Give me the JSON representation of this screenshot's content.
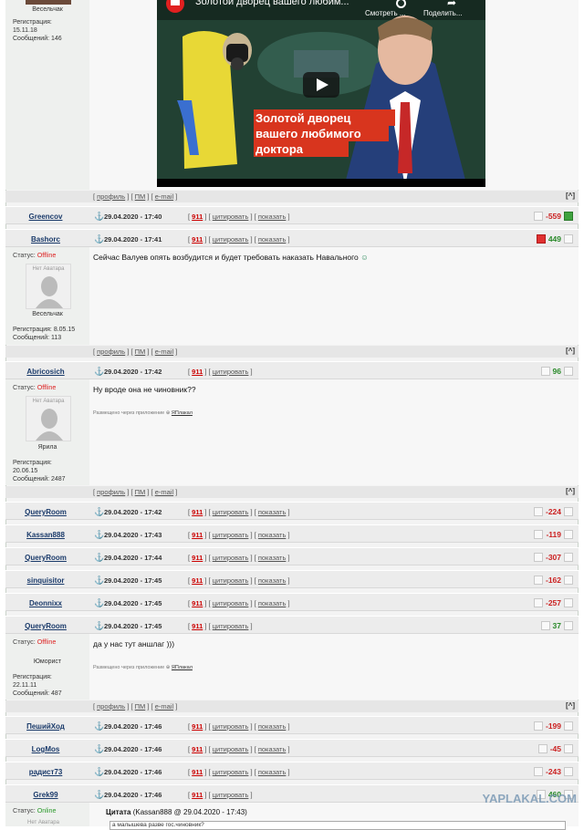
{
  "top": {
    "role": "Весельчак",
    "reg_label": "Регистрация:",
    "reg_date": "15.11.18",
    "posts": "Сообщений: 146",
    "video": {
      "title": "Золотой дворец вашего любим...",
      "watch_later": "Смотреть ...",
      "share": "Поделить...",
      "headline": "Золотой дворец вашего любимого доктора"
    }
  },
  "footer": {
    "profile": "профиль",
    "pm": "ПМ",
    "email": "e-mail",
    "top": "[^]"
  },
  "links": {
    "report": "911",
    "quote": "цитировать",
    "show": "показать"
  },
  "posts": [
    {
      "user": "Greencov",
      "date": "29.04.2020 - 17:40",
      "score": "-559"
    },
    {
      "user": "Bashorc",
      "date": "29.04.2020 - 17:41",
      "score": "449",
      "status_label": "Статус:",
      "status": "Offline",
      "avatar_caption": "Нет Аватара",
      "role": "Весельчак",
      "reg_label": "Регистрация:",
      "reg_date": "8.05.15",
      "posts_count": "Сообщений: 113",
      "text": "Сейчас Валуев опять возбудится и будет требовать наказать Навального"
    },
    {
      "user": "Abricosich",
      "date": "29.04.2020 - 17:42",
      "score": "96",
      "status_label": "Статус:",
      "status": "Offline",
      "avatar_caption": "Нет Аватара",
      "role": "Ярила",
      "reg_label": "Регистрация:",
      "reg_date": "20.06.15",
      "posts_count": "Сообщений: 2487",
      "text": "Ну вроде она не чиновник??",
      "via": "Размещено через приложение",
      "app": "ЯПлакал"
    },
    {
      "user": "QueryRoom",
      "date": "29.04.2020 - 17:42",
      "score": "-224"
    },
    {
      "user": "Kassan888",
      "date": "29.04.2020 - 17:43",
      "score": "-119"
    },
    {
      "user": "QueryRoom",
      "date": "29.04.2020 - 17:44",
      "score": "-307"
    },
    {
      "user": "sinquisitor",
      "date": "29.04.2020 - 17:45",
      "score": "-162"
    },
    {
      "user": "Deonnixx",
      "date": "29.04.2020 - 17:45",
      "score": "-257"
    },
    {
      "user": "QueryRoom",
      "date": "29.04.2020 - 17:45",
      "score": "37",
      "status_label": "Статус:",
      "status": "Offline",
      "role": "Юморист",
      "reg_label": "Регистрация:",
      "reg_date": "22.11.11",
      "posts_count": "Сообщений: 487",
      "text": "да у нас тут аншлаг )))",
      "via": "Размещено через приложение",
      "app": "ЯПлакал"
    },
    {
      "user": "ПешийХод",
      "date": "29.04.2020 - 17:46",
      "score": "-199"
    },
    {
      "user": "LogMos",
      "date": "29.04.2020 - 17:46",
      "score": "-45"
    },
    {
      "user": "радист73",
      "date": "29.04.2020 - 17:46",
      "score": "-243"
    },
    {
      "user": "Grek99",
      "date": "29.04.2020 - 17:46",
      "score": "460",
      "status_label": "Статус:",
      "status": "Online",
      "avatar_caption": "Нет Аватара",
      "quote_label": "Цитата",
      "quote_meta": "(Kassan888 @ 29.04.2020 - 17:43)",
      "quote_text": "а малышева разве гос.чиновник?"
    }
  ],
  "watermark": "YAPLAKAL.COM"
}
